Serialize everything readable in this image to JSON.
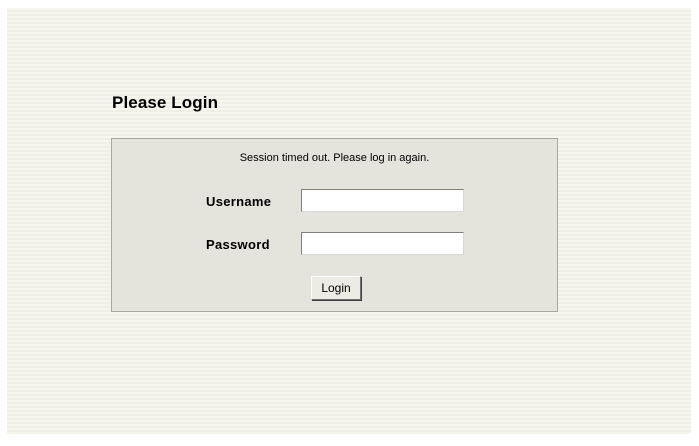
{
  "page": {
    "title": "Please Login"
  },
  "login_form": {
    "status_message": "Session timed out. Please log in again.",
    "username_label": "Username",
    "username_value": "",
    "password_label": "Password",
    "password_value": "",
    "submit_label": "Login"
  },
  "colors": {
    "background": "#f4f4ec",
    "panel": "#e4e4dc",
    "panel_border": "#a8a8a0"
  }
}
